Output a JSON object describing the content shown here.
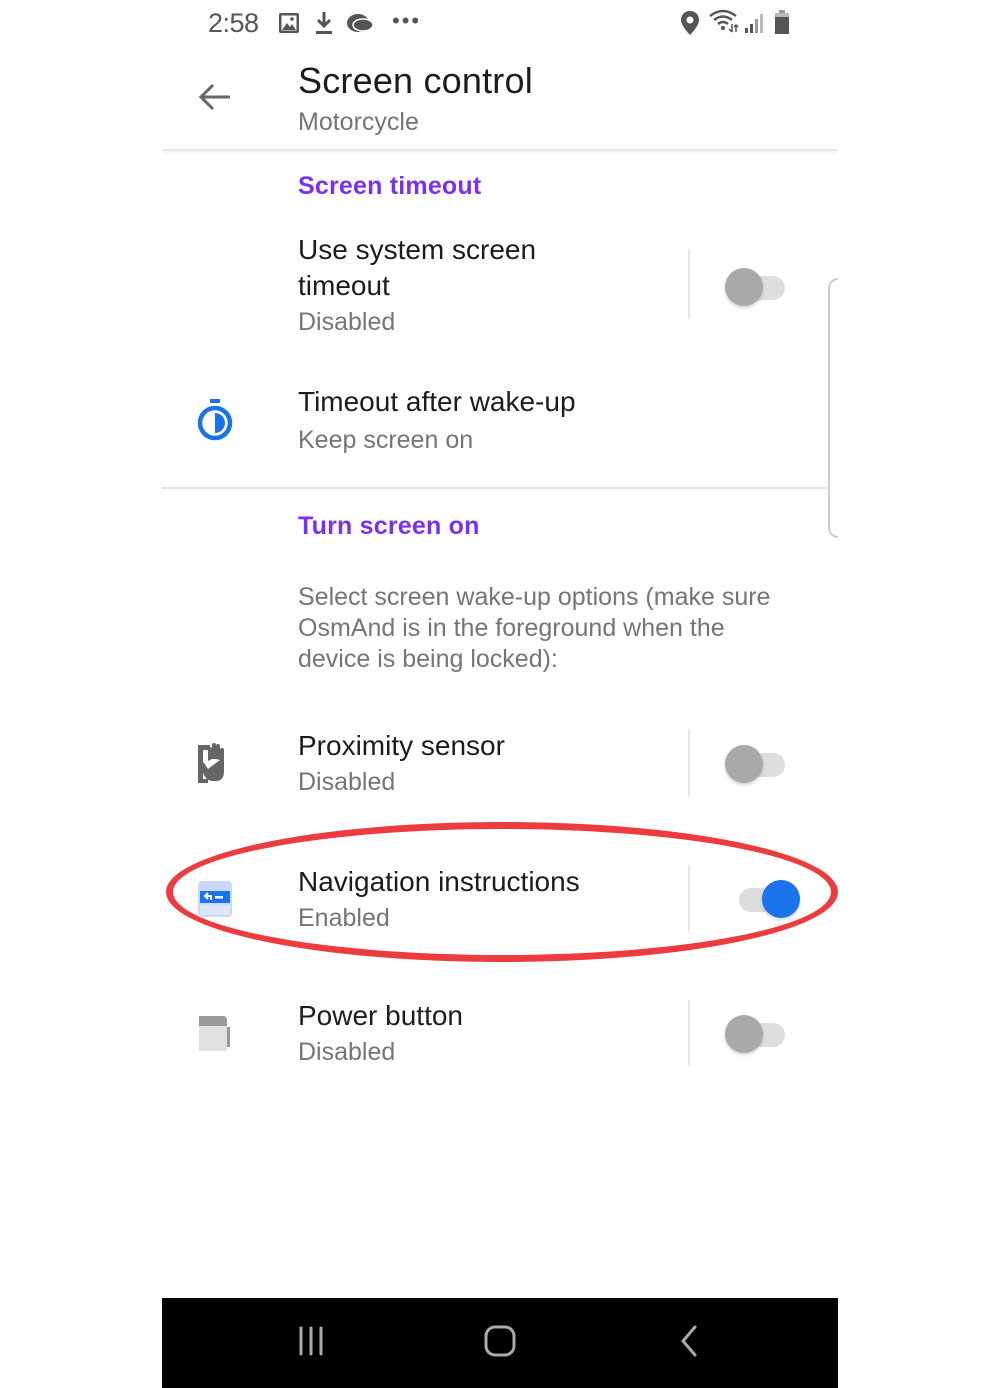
{
  "status_bar": {
    "time": "2:58",
    "left_icons": [
      "gallery-icon",
      "download-icon",
      "app-notification-icon",
      "more-dots-icon"
    ],
    "right_icons": [
      "location-icon",
      "wifi-icon",
      "signal-icon",
      "battery-icon"
    ]
  },
  "toolbar": {
    "title": "Screen control",
    "subtitle": "Motorcycle",
    "back_icon": "arrow-back-icon"
  },
  "sections": [
    {
      "header": "Screen timeout",
      "items": [
        {
          "title": "Use system screen timeout",
          "title_lines": [
            "Use system screen",
            "timeout"
          ],
          "status": "Disabled",
          "toggle": false,
          "icon": null
        },
        {
          "title": "Timeout after wake-up",
          "status": "Keep screen on",
          "icon": "stopwatch-icon"
        }
      ]
    },
    {
      "header": "Turn screen on",
      "description": "Select screen wake-up options (make sure OsmAnd is in the foreground when the device is being locked):",
      "items": [
        {
          "title": "Proximity sensor",
          "status": "Disabled",
          "toggle": false,
          "icon": "hand-phone-icon"
        },
        {
          "title": "Navigation instructions",
          "status": "Enabled",
          "toggle": true,
          "icon": "navigation-instruction-icon",
          "highlighted": true
        },
        {
          "title": "Power button",
          "status": "Disabled",
          "toggle": false,
          "icon": "power-button-icon"
        }
      ]
    }
  ],
  "colors": {
    "section_header": "#7b2ff2",
    "toggle_on": "#1a73e8",
    "toggle_off": "#a9a9a9",
    "annotation": "#ec3c3f",
    "icon_blue": "#1a73e8"
  },
  "nav_bar": {
    "buttons": [
      "recent-apps",
      "home",
      "back"
    ]
  }
}
